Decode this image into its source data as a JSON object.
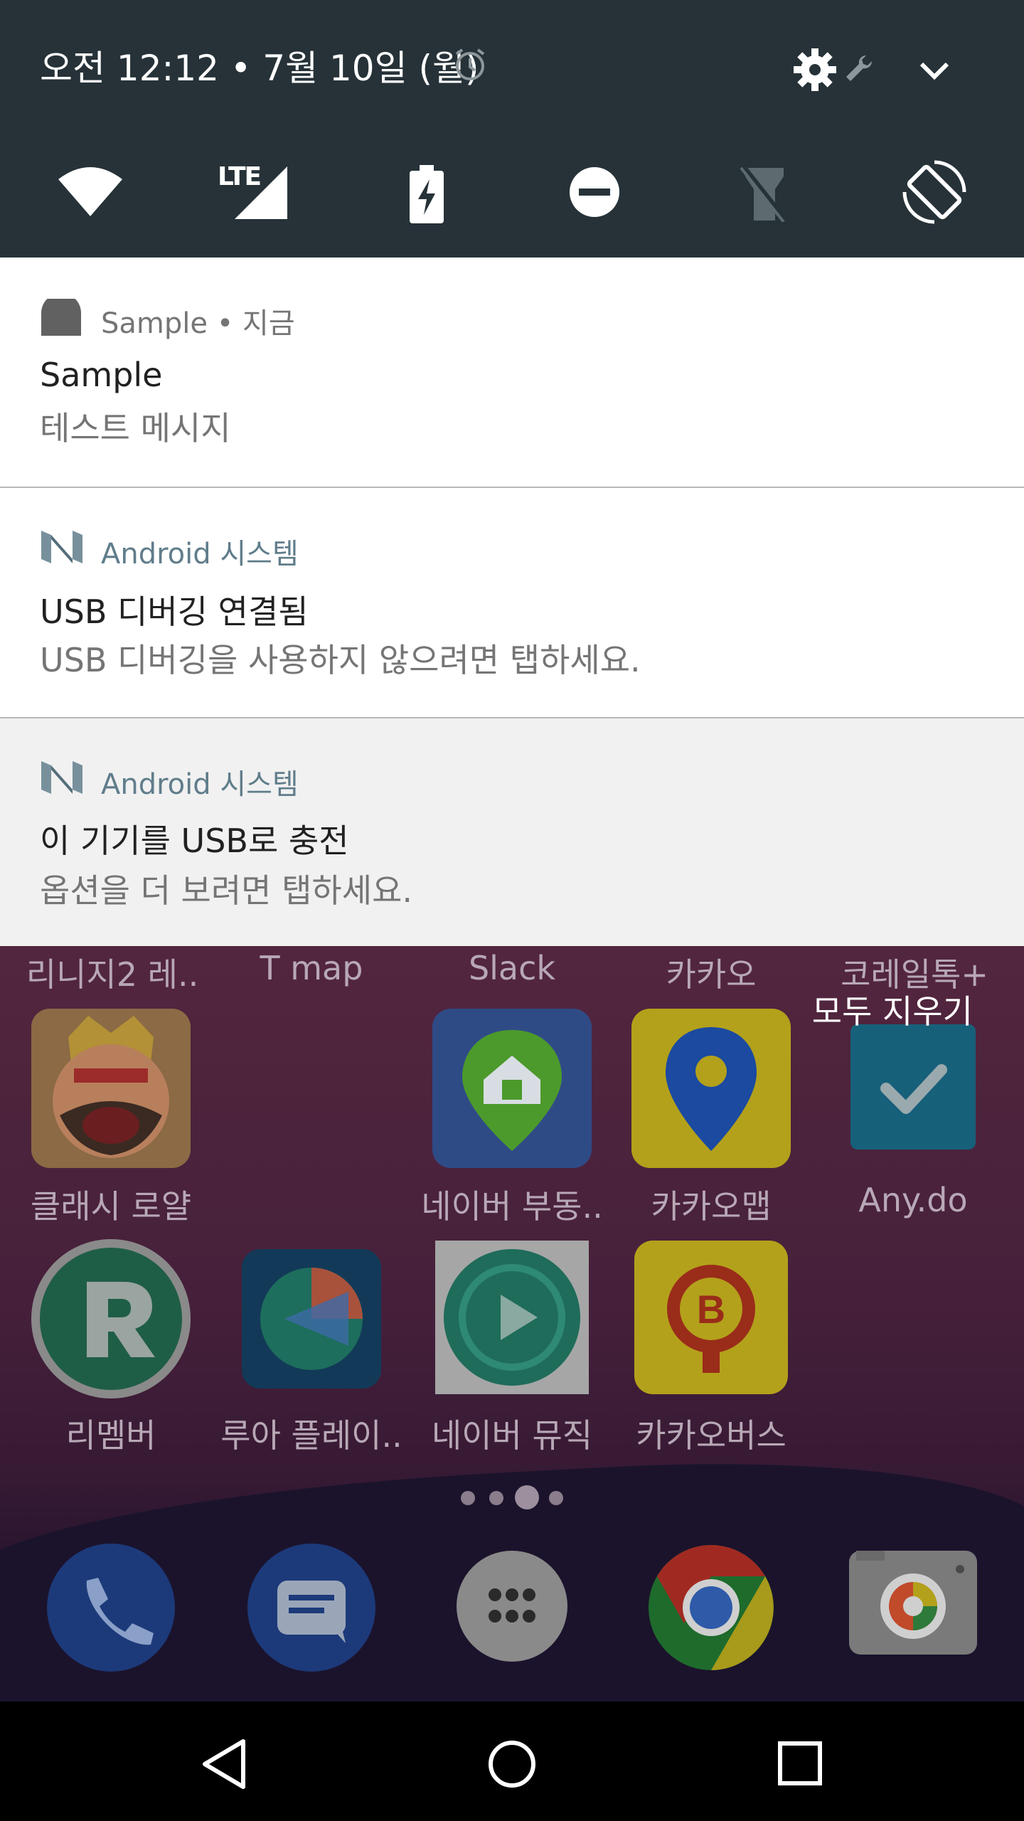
{
  "status": {
    "datetime": "오전 12:12 • 7월 10일 (월)",
    "icons": [
      "alarm-icon",
      "settings-icon",
      "wrench-icon",
      "expand-icon"
    ]
  },
  "quick_settings": {
    "tiles": [
      "wifi-icon",
      "lte-signal-icon",
      "battery-charging-icon",
      "do-not-disturb-icon",
      "flashlight-icon",
      "auto-rotate-icon"
    ],
    "lte_label": "LTE"
  },
  "notifications": [
    {
      "app": "Sample • 지금",
      "title": "Sample",
      "body": "테스트 메시지"
    },
    {
      "app": "Android 시스템",
      "title": "USB 디버깅 연결됨",
      "body": "USB 디버깅을 사용하지 않으려면 탭하세요."
    },
    {
      "app": "Android 시스템",
      "title": "이 기기를 USB로 충전",
      "body": "옵션을 더 보려면 탭하세요."
    }
  ],
  "clear_all": "모두 지우기",
  "home": {
    "row0_labels": [
      "리니지2 레..",
      "T map",
      "Slack",
      "카카오",
      "코레일톡+"
    ],
    "row1_labels": [
      "클래시 로얄",
      "",
      "네이버 부동..",
      "카카오맵",
      "Any.do"
    ],
    "row2_labels": [
      "리멤버",
      "루아 플레이..",
      "네이버 뮤직",
      "카카오버스",
      ""
    ]
  },
  "colors": {
    "shade": "#263238",
    "accent": "#607d8b"
  }
}
